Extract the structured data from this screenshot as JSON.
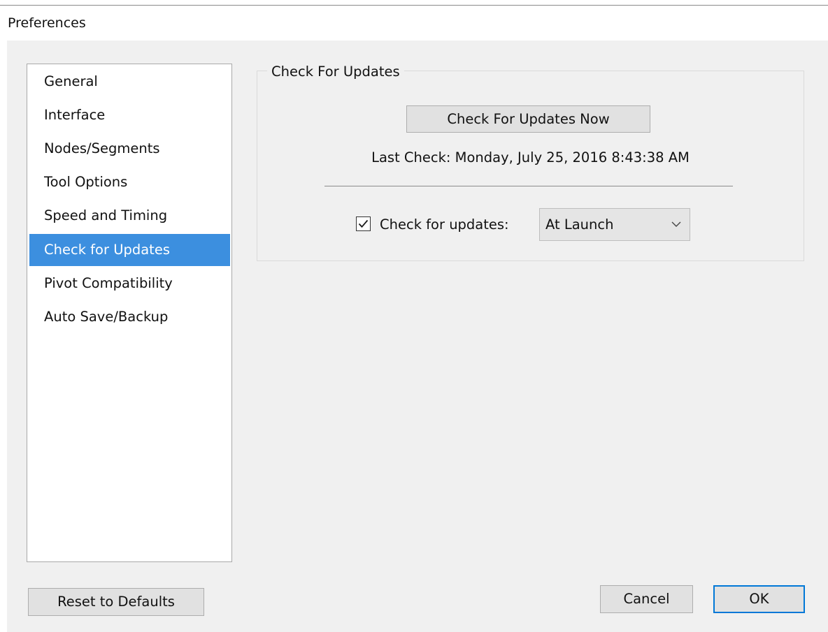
{
  "window": {
    "title": "Preferences"
  },
  "sidebar": {
    "selected_index": 5,
    "items": [
      {
        "label": "General"
      },
      {
        "label": "Interface"
      },
      {
        "label": "Nodes/Segments"
      },
      {
        "label": "Tool Options"
      },
      {
        "label": "Speed and Timing"
      },
      {
        "label": "Check for Updates"
      },
      {
        "label": "Pivot Compatibility"
      },
      {
        "label": "Auto Save/Backup"
      }
    ]
  },
  "updates": {
    "group_title": "Check For Updates",
    "check_now_label": "Check For Updates Now",
    "last_check": "Last Check: Monday, July 25, 2016 8:43:38 AM",
    "auto_check_label": "Check for updates:",
    "auto_check_enabled": true,
    "frequency": {
      "selected": "At Launch"
    }
  },
  "footer": {
    "reset_label": "Reset to Defaults",
    "cancel_label": "Cancel",
    "ok_label": "OK"
  },
  "colors": {
    "selection": "#3c8fdf",
    "default_button_border": "#0078d7",
    "dialog_background": "#f0f0f0"
  },
  "icons": {
    "checkbox_mark": "check-icon",
    "dropdown": "chevron-down-icon"
  }
}
